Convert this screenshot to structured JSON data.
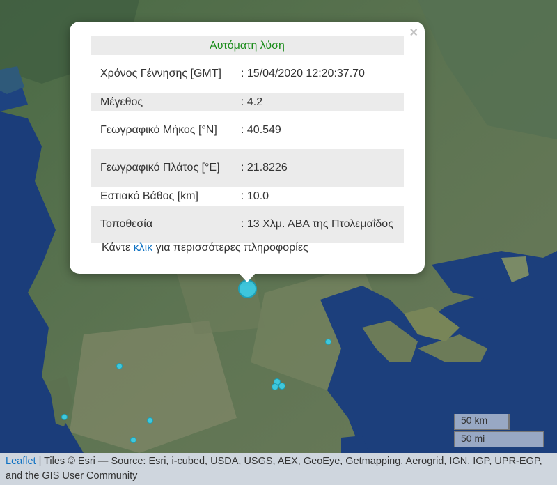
{
  "popup": {
    "title": "Αυτόματη λύση",
    "close": "×",
    "rows": [
      {
        "label": "Χρόνος Γέννησης [GMT]",
        "value": ": 15/04/2020 12:20:37.70"
      },
      {
        "label": "Μέγεθος",
        "value": ": 4.2"
      },
      {
        "label": "Γεωγραφικό Μήκος [°N]",
        "value": ": 40.549"
      },
      {
        "label": "Γεωγραφικό Πλάτος [°E]",
        "value": ": 21.8226"
      },
      {
        "label": "Εστιακό Βάθος [km]",
        "value": ": 10.0"
      },
      {
        "label": "Τοποθεσία",
        "value": ": 13 Χλμ. ΑΒΑ της Πτολεμαΐδος"
      }
    ],
    "more_prefix": "Κάντε ",
    "more_link": "κλικ",
    "more_suffix": " για περισσότερες πληροφορίες"
  },
  "scale": {
    "km": "50 km",
    "mi": "50 mi"
  },
  "attribution": {
    "link": "Leaflet",
    "text": " | Tiles © Esri — Source: Esri, i-cubed, USDA, USGS, AEX, GeoEye, Getmapping, Aerogrid, IGN, IGP, UPR-EGP, and the GIS User Community"
  },
  "colors": {
    "marker": "#40c8dc",
    "title": "#1a8c1a",
    "link": "#1173c3"
  }
}
